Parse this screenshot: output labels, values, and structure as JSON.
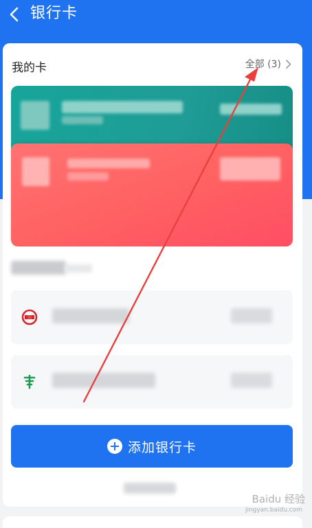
{
  "header": {
    "title": "银行卡",
    "back_icon": "chevron-left-icon"
  },
  "my_cards": {
    "title": "我的卡",
    "all_link": "全部 (3)",
    "chevron_icon": "chevron-right-icon"
  },
  "add_card": {
    "label": "添加银行卡",
    "icon": "plus-circle-icon"
  },
  "watermark": {
    "text": "Baidu 经验",
    "sub": "jingyan.baidu.com"
  },
  "colors": {
    "brand": "#1f73f1",
    "teal_card": "#17a59a",
    "red_card": "#ff6262",
    "arrow": "#e8413d"
  }
}
